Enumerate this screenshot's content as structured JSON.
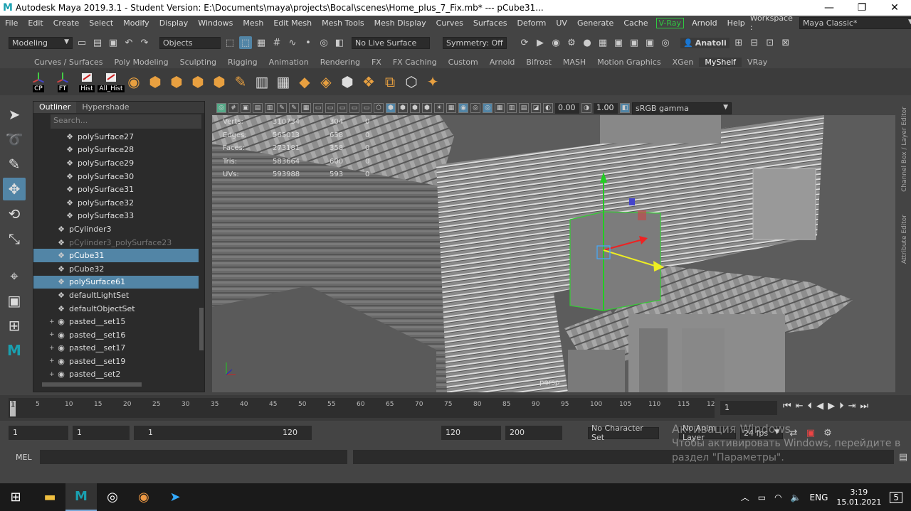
{
  "window": {
    "title": "Autodesk Maya 2019.3.1 - Student Version: E:\\Documents\\maya\\projects\\Bocal\\scenes\\Home_plus_7_Fix.mb*   ---   pCube31...",
    "minimize": "—",
    "maximize": "❐",
    "close": "✕"
  },
  "menubar": {
    "items": [
      "File",
      "Edit",
      "Create",
      "Select",
      "Modify",
      "Display",
      "Windows",
      "Mesh",
      "Edit Mesh",
      "Mesh Tools",
      "Mesh Display",
      "Curves",
      "Surfaces",
      "Deform",
      "UV",
      "Generate",
      "Cache"
    ],
    "vray": "V-Ray",
    "items2": [
      "Arnold",
      "Help"
    ],
    "workspace_label": "Workspace :",
    "workspace_value": "Maya Classic*"
  },
  "statusline": {
    "mode": "Modeling",
    "objects": "Objects",
    "live_surface": "No Live Surface",
    "symmetry": "Symmetry: Off",
    "user": "Anatoli"
  },
  "shelf_tabs": [
    "Curves / Surfaces",
    "Poly Modeling",
    "Sculpting",
    "Rigging",
    "Animation",
    "Rendering",
    "FX",
    "FX Caching",
    "Custom",
    "Arnold",
    "Bifrost",
    "MASH",
    "Motion Graphics",
    "XGen",
    "MyShelf",
    "VRay"
  ],
  "shelf_active": "MyShelf",
  "shelf_buttons": [
    "CP",
    "FT",
    "Hist",
    "All_Hist"
  ],
  "outliner": {
    "tabs": [
      "Outliner",
      "Hypershade"
    ],
    "search_placeholder": "Search...",
    "rows": [
      {
        "label": "polySurface27",
        "indent": 2,
        "sel": false,
        "dim": false,
        "expand": ""
      },
      {
        "label": "polySurface28",
        "indent": 2,
        "sel": false,
        "dim": false,
        "expand": ""
      },
      {
        "label": "polySurface29",
        "indent": 2,
        "sel": false,
        "dim": false,
        "expand": ""
      },
      {
        "label": "polySurface30",
        "indent": 2,
        "sel": false,
        "dim": false,
        "expand": ""
      },
      {
        "label": "polySurface31",
        "indent": 2,
        "sel": false,
        "dim": false,
        "expand": ""
      },
      {
        "label": "polySurface32",
        "indent": 2,
        "sel": false,
        "dim": false,
        "expand": ""
      },
      {
        "label": "polySurface33",
        "indent": 2,
        "sel": false,
        "dim": false,
        "expand": ""
      },
      {
        "label": "pCylinder3",
        "indent": 1,
        "sel": false,
        "dim": false,
        "expand": ""
      },
      {
        "label": "pCylinder3_polySurface23",
        "indent": 1,
        "sel": false,
        "dim": true,
        "expand": ""
      },
      {
        "label": "pCube31",
        "indent": 1,
        "sel": true,
        "dim": false,
        "expand": ""
      },
      {
        "label": "pCube32",
        "indent": 1,
        "sel": false,
        "dim": false,
        "expand": ""
      },
      {
        "label": "polySurface61",
        "indent": 1,
        "sel": true,
        "dim": false,
        "expand": ""
      },
      {
        "label": "defaultLightSet",
        "indent": 1,
        "sel": false,
        "dim": false,
        "expand": ""
      },
      {
        "label": "defaultObjectSet",
        "indent": 1,
        "sel": false,
        "dim": false,
        "expand": ""
      },
      {
        "label": "pasted__set15",
        "indent": 1,
        "sel": false,
        "dim": false,
        "expand": "+"
      },
      {
        "label": "pasted__set16",
        "indent": 1,
        "sel": false,
        "dim": false,
        "expand": "+"
      },
      {
        "label": "pasted__set17",
        "indent": 1,
        "sel": false,
        "dim": false,
        "expand": "+"
      },
      {
        "label": "pasted__set19",
        "indent": 1,
        "sel": false,
        "dim": false,
        "expand": "+"
      },
      {
        "label": "pasted__set2",
        "indent": 1,
        "sel": false,
        "dim": false,
        "expand": "+"
      }
    ]
  },
  "viewport": {
    "val1": "0.00",
    "val2": "1.00",
    "colorspace": "sRGB gamma",
    "camera": "persp",
    "hud": [
      {
        "label": "Verts:",
        "a": "310734",
        "b": "304",
        "c": "0"
      },
      {
        "label": "Edges:",
        "a": "565013",
        "b": "658",
        "c": "0"
      },
      {
        "label": "Faces:",
        "a": "273181",
        "b": "358",
        "c": "0"
      },
      {
        "label": "Tris:",
        "a": "583664",
        "b": "600",
        "c": "0"
      },
      {
        "label": "UVs:",
        "a": "593988",
        "b": "593",
        "c": "0"
      }
    ]
  },
  "rightbar": [
    "Channel Box / Layer Editor",
    "Attribute Editor"
  ],
  "timeline": {
    "ticks": [
      "5",
      "10",
      "15",
      "20",
      "25",
      "30",
      "35",
      "40",
      "45",
      "50",
      "55",
      "60",
      "65",
      "70",
      "75",
      "80",
      "85",
      "90",
      "95",
      "100",
      "105",
      "110",
      "115",
      "12"
    ],
    "current_frame_marker": "1",
    "current_frame": "1"
  },
  "range": {
    "start": "1",
    "start2": "1",
    "slider_start": "1",
    "slider_end": "120",
    "end": "120",
    "end2": "200",
    "char_set": "No Character Set",
    "anim_layer": "No Anim Layer",
    "fps": "24 fps"
  },
  "mel": {
    "label": "MEL"
  },
  "activation": {
    "line1": "Активация Windows",
    "line2": "Чтобы активировать Windows, перейдите в",
    "line3": "раздел \"Параметры\"."
  },
  "taskbar": {
    "lang": "ENG",
    "time": "3:19",
    "date": "15.01.2021",
    "notif": "5"
  }
}
